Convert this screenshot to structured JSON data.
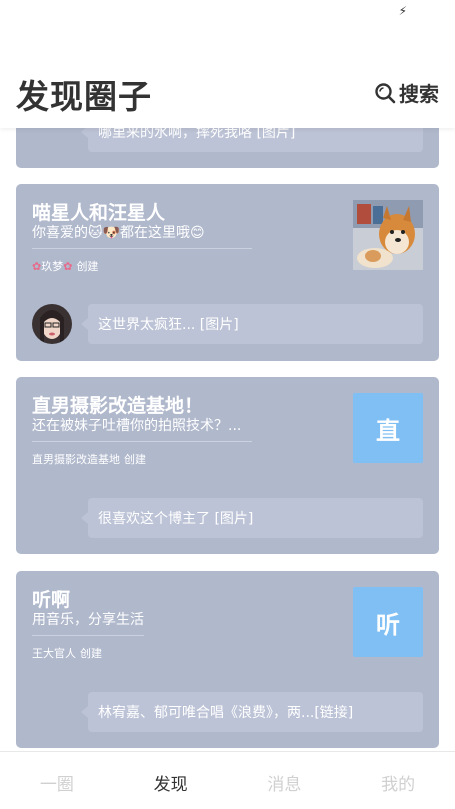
{
  "status": {
    "icon": "charging-bolt-icon"
  },
  "header": {
    "title": "发现圈子",
    "search_label": "搜索"
  },
  "cards": [
    {
      "bubble": "哪里来的水啊，摔死我咯 [图片]"
    },
    {
      "title": "喵星人和汪星人",
      "desc_prefix": "你喜爱的",
      "desc_emoji": "🐱🐶",
      "desc_suffix": "都在这里哦",
      "desc_end_emoji": "😊",
      "creator": "玖梦",
      "created": "创建",
      "thumb": "dog-cat-photo",
      "bubble": "这世界太疯狂... [图片]"
    },
    {
      "title": "直男摄影改造基地！",
      "desc": "还在被妹子吐槽你的拍照技术？...",
      "creator": "直男摄影改造基地",
      "created": "创建",
      "thumb_letter": "直",
      "bubble": "很喜欢这个博主了 [图片]"
    },
    {
      "title": "听啊",
      "desc": "用音乐，分享生活",
      "creator": "王大官人",
      "created": "创建",
      "thumb_letter": "听",
      "bubble": "林宥嘉、郁可唯合唱《浪费》，两...[链接]"
    }
  ],
  "tabs": [
    {
      "label": "一圈",
      "active": false
    },
    {
      "label": "发现",
      "active": true
    },
    {
      "label": "消息",
      "active": false
    },
    {
      "label": "我的",
      "active": false
    }
  ]
}
